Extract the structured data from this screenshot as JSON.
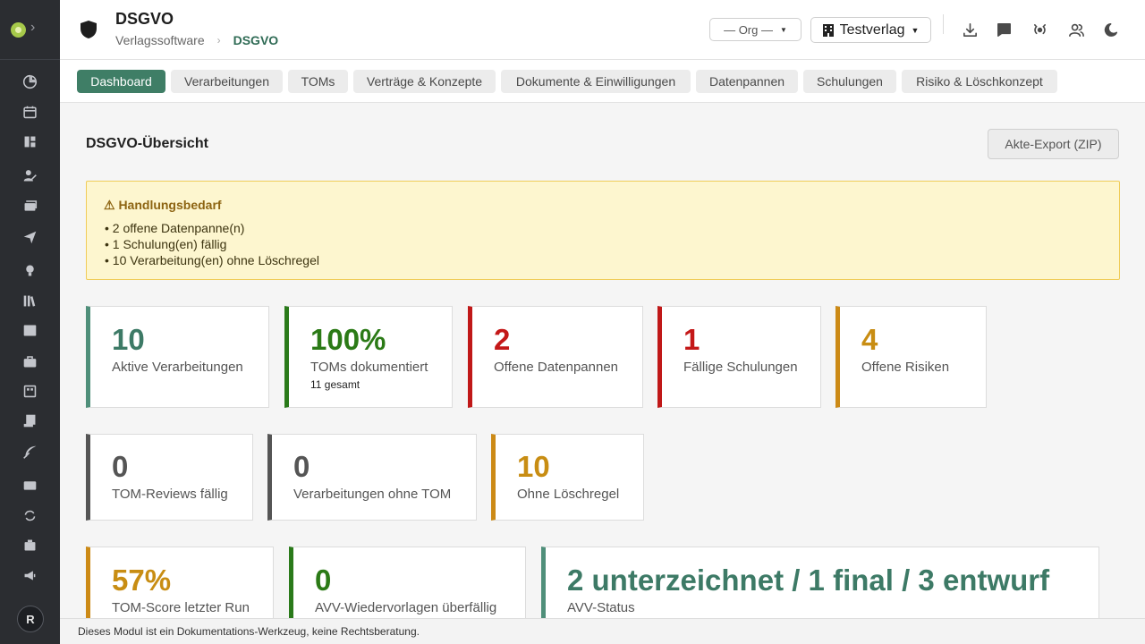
{
  "sidebar": {
    "items": [
      {
        "icon": "pie-chart-icon"
      },
      {
        "icon": "calendar-icon"
      },
      {
        "icon": "dashboard-icon"
      },
      {
        "icon": "user-edit-icon"
      },
      {
        "icon": "mail-stack-icon"
      },
      {
        "icon": "send-icon"
      },
      {
        "icon": "lightbulb-icon"
      },
      {
        "icon": "library-icon"
      },
      {
        "icon": "image-icon"
      },
      {
        "icon": "briefcase-icon"
      },
      {
        "icon": "board-icon"
      },
      {
        "icon": "scroll-icon"
      },
      {
        "icon": "feather-icon"
      },
      {
        "icon": "credit-card-icon"
      },
      {
        "icon": "sync-icon"
      },
      {
        "icon": "case-icon"
      },
      {
        "icon": "megaphone-icon"
      }
    ],
    "avatar": "R"
  },
  "header": {
    "title": "DSGVO",
    "breadcrumb": [
      "Verlagssoftware",
      "DSGVO"
    ],
    "org_select": "— Org —",
    "publisher_select": "Testverlag"
  },
  "tabs": [
    {
      "label": "Dashboard",
      "active": true
    },
    {
      "label": "Verarbeitungen"
    },
    {
      "label": "TOMs"
    },
    {
      "label": "Verträge & Konzepte"
    },
    {
      "label": "Dokumente & Einwilligungen"
    },
    {
      "label": "Datenpannen"
    },
    {
      "label": "Schulungen"
    },
    {
      "label": "Risiko & Löschkonzept"
    }
  ],
  "main": {
    "title": "DSGVO-Übersicht",
    "export_label": "Akte-Export (ZIP)",
    "alert": {
      "title": "⚠ Handlungsbedarf",
      "items": [
        "2 offene Datenpanne(n)",
        "1 Schulung(en) fällig",
        "10 Verarbeitung(en) ohne Löschregel"
      ]
    },
    "cards": [
      {
        "value": "10",
        "label": "Aktive Verarbeitungen"
      },
      {
        "value": "100%",
        "label": "TOMs dokumentiert",
        "sub": "11 gesamt"
      },
      {
        "value": "2",
        "label": "Offene Datenpannen"
      },
      {
        "value": "1",
        "label": "Fällige Schulungen"
      },
      {
        "value": "4",
        "label": "Offene Risiken"
      },
      {
        "value": "0",
        "label": "TOM-Reviews fällig"
      },
      {
        "value": "0",
        "label": "Verarbeitungen ohne TOM"
      },
      {
        "value": "10",
        "label": "Ohne Löschregel"
      },
      {
        "value": "57%",
        "label": "TOM-Score letzter Run"
      },
      {
        "value": "0",
        "label": "AVV-Wiedervorlagen überfällig"
      },
      {
        "value": "2 unterzeichnet / 1 final / 3 entwurf",
        "label": "AVV-Status"
      }
    ]
  },
  "colors": {
    "teal": "#3d7a66",
    "green": "#2b7a16",
    "red": "#c41818",
    "amber": "#c88d13",
    "gray": "#555555",
    "sidebar": "#2b2d31"
  },
  "footer": {
    "text": "Dieses Modul ist ein Dokumentations-Werkzeug, keine Rechtsberatung."
  }
}
